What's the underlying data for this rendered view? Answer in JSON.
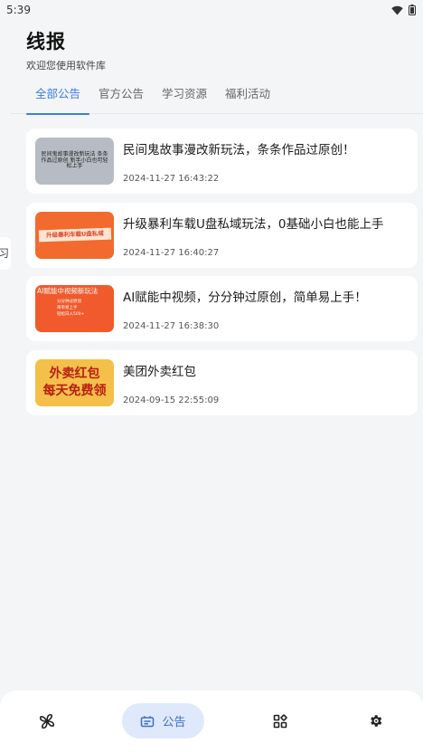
{
  "status_bar": {
    "time": "5:39"
  },
  "header": {
    "title": "线报",
    "subtitle": "欢迎您使用软件库"
  },
  "tabs": [
    {
      "label": "全部公告",
      "active": true
    },
    {
      "label": "官方公告",
      "active": false
    },
    {
      "label": "学习资源",
      "active": false
    },
    {
      "label": "福利活动",
      "active": false
    }
  ],
  "side_peek": {
    "text": "习"
  },
  "items": [
    {
      "title": "民间鬼故事漫改新玩法，条条作品过原创！",
      "date": "2024-11-27 16:43:22",
      "thumb_text": "民间鬼故事漫改新玩法 条条作品过原创 新手小白也可轻松上手"
    },
    {
      "title": "升级暴利车载U盘私域玩法，0基础小白也能上手",
      "date": "2024-11-27 16:40:27",
      "thumb_text": "升级暴利车载U盘私域"
    },
    {
      "title": "AI赋能中视频，分分钟过原创，简单易上手！",
      "date": "2024-11-27 16:38:30",
      "thumb_text": "AI赋能中视频新玩法",
      "thumb_sub": [
        "分分钟过原创",
        "简单易上手",
        "轻松日入500+"
      ]
    },
    {
      "title": "美团外卖红包",
      "date": "2024-09-15 22:55:09",
      "thumb_lines": [
        "外卖红包",
        "每天免费领"
      ]
    }
  ],
  "bottom_nav": {
    "active_label": "公告",
    "items": [
      "fan-icon",
      "notice-icon",
      "apps-icon",
      "settings-icon"
    ]
  },
  "colors": {
    "accent": "#3b7ddd",
    "nav_active_bg": "#dfe9fb"
  }
}
